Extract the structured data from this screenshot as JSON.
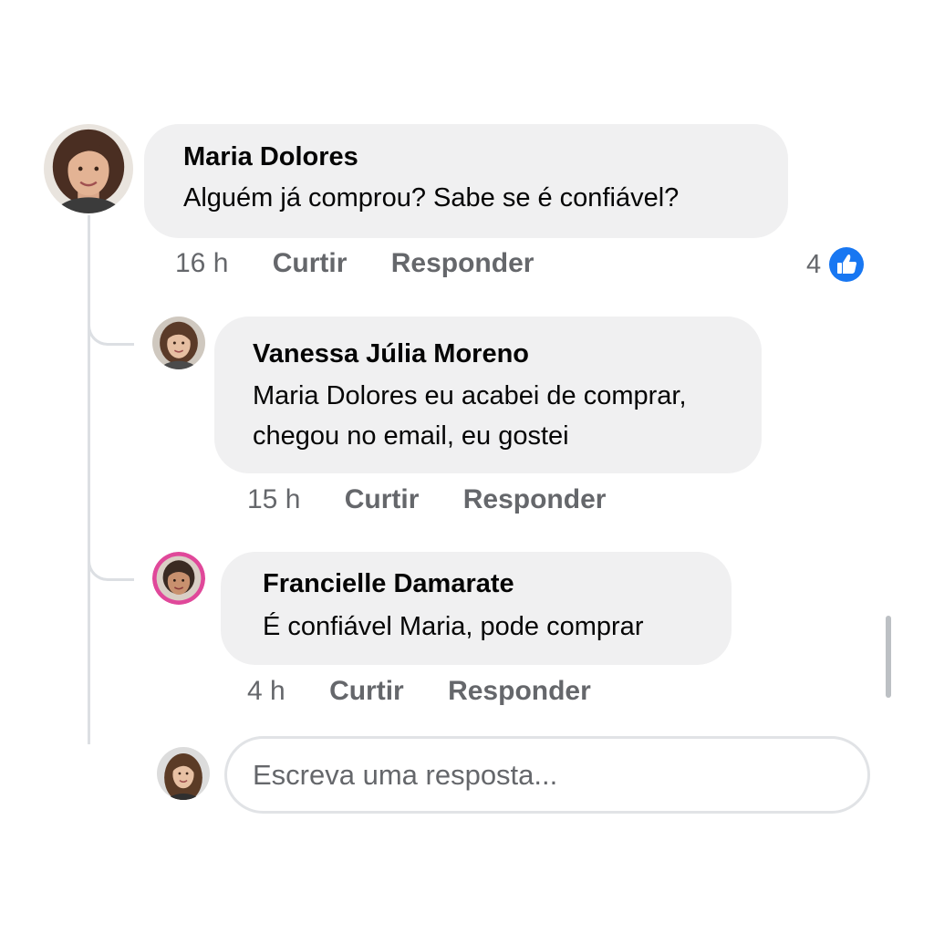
{
  "comments": [
    {
      "author": "Maria Dolores",
      "text": "Alguém já comprou? Sabe se é confiável?",
      "time": "16 h",
      "like_label": "Curtir",
      "reply_label": "Responder",
      "reaction_count": "4",
      "reaction_icon": "like-icon"
    }
  ],
  "replies": [
    {
      "author": "Vanessa Júlia Moreno",
      "text_line1": "Maria Dolores eu acabei de comprar,",
      "text_line2": "chegou no email, eu gostei",
      "time": "15 h",
      "like_label": "Curtir",
      "reply_label": "Responder"
    },
    {
      "author": "Francielle Damarate",
      "text": "É confiável Maria, pode comprar",
      "time": "4 h",
      "like_label": "Curtir",
      "reply_label": "Responder"
    }
  ],
  "reply_box": {
    "placeholder": "Escreva uma resposta..."
  },
  "colors": {
    "bubble": "#f0f0f1",
    "muted_text": "#65676b",
    "like_blue": "#1877f2"
  }
}
